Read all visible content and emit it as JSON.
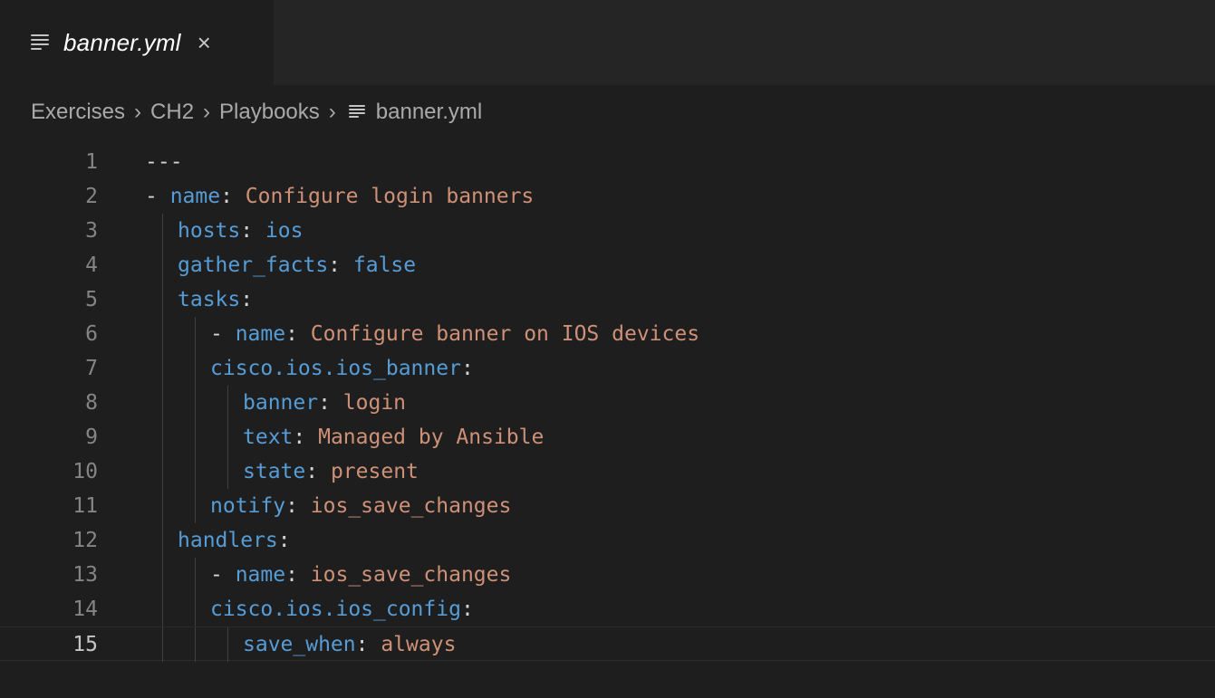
{
  "tab": {
    "label": "banner.yml",
    "close_glyph": "×",
    "icon": "file-lines-icon"
  },
  "breadcrumb": [
    "Exercises",
    "CH2",
    "Playbooks",
    "banner.yml"
  ],
  "breadcrumb_separator": "›",
  "colors": {
    "background": "#1e1e1e",
    "tabbar": "#252526",
    "key": "#569cd6",
    "string": "#ce9178",
    "punctuation": "#d4d4d4",
    "line_number": "#858585"
  },
  "current_line": 15,
  "code_lines": [
    {
      "n": "1",
      "indent": 0,
      "parts": [
        {
          "t": "---",
          "c": "p"
        }
      ]
    },
    {
      "n": "2",
      "indent": 0,
      "parts": [
        {
          "t": "- ",
          "c": "p"
        },
        {
          "t": "name",
          "c": "k"
        },
        {
          "t": ": ",
          "c": "p"
        },
        {
          "t": "Configure login banners",
          "c": "v"
        }
      ]
    },
    {
      "n": "3",
      "indent": 1,
      "parts": [
        {
          "t": "hosts",
          "c": "k"
        },
        {
          "t": ": ",
          "c": "p"
        },
        {
          "t": "ios",
          "c": "k"
        }
      ]
    },
    {
      "n": "4",
      "indent": 1,
      "parts": [
        {
          "t": "gather_facts",
          "c": "k"
        },
        {
          "t": ": ",
          "c": "p"
        },
        {
          "t": "false",
          "c": "k"
        }
      ]
    },
    {
      "n": "5",
      "indent": 1,
      "parts": [
        {
          "t": "tasks",
          "c": "k"
        },
        {
          "t": ":",
          "c": "p"
        }
      ]
    },
    {
      "n": "6",
      "indent": 2,
      "parts": [
        {
          "t": "- ",
          "c": "p"
        },
        {
          "t": "name",
          "c": "k"
        },
        {
          "t": ": ",
          "c": "p"
        },
        {
          "t": "Configure banner on IOS devices",
          "c": "v"
        }
      ]
    },
    {
      "n": "7",
      "indent": 2,
      "parts": [
        {
          "t": "cisco.ios.ios_banner",
          "c": "k"
        },
        {
          "t": ":",
          "c": "p"
        }
      ]
    },
    {
      "n": "8",
      "indent": 3,
      "parts": [
        {
          "t": "banner",
          "c": "k"
        },
        {
          "t": ": ",
          "c": "p"
        },
        {
          "t": "login",
          "c": "v"
        }
      ]
    },
    {
      "n": "9",
      "indent": 3,
      "parts": [
        {
          "t": "text",
          "c": "k"
        },
        {
          "t": ": ",
          "c": "p"
        },
        {
          "t": "Managed by Ansible",
          "c": "v"
        }
      ]
    },
    {
      "n": "10",
      "indent": 3,
      "parts": [
        {
          "t": "state",
          "c": "k"
        },
        {
          "t": ": ",
          "c": "p"
        },
        {
          "t": "present",
          "c": "v"
        }
      ]
    },
    {
      "n": "11",
      "indent": 2,
      "parts": [
        {
          "t": "notify",
          "c": "k"
        },
        {
          "t": ": ",
          "c": "p"
        },
        {
          "t": "ios_save_changes",
          "c": "v"
        }
      ]
    },
    {
      "n": "12",
      "indent": 1,
      "parts": [
        {
          "t": "handlers",
          "c": "k"
        },
        {
          "t": ":",
          "c": "p"
        }
      ]
    },
    {
      "n": "13",
      "indent": 2,
      "parts": [
        {
          "t": "- ",
          "c": "p"
        },
        {
          "t": "name",
          "c": "k"
        },
        {
          "t": ": ",
          "c": "p"
        },
        {
          "t": "ios_save_changes",
          "c": "v"
        }
      ]
    },
    {
      "n": "14",
      "indent": 2,
      "parts": [
        {
          "t": "cisco.ios.ios_config",
          "c": "k"
        },
        {
          "t": ":",
          "c": "p"
        }
      ]
    },
    {
      "n": "15",
      "indent": 3,
      "parts": [
        {
          "t": "save_when",
          "c": "k"
        },
        {
          "t": ": ",
          "c": "p"
        },
        {
          "t": "always",
          "c": "v"
        }
      ]
    }
  ]
}
